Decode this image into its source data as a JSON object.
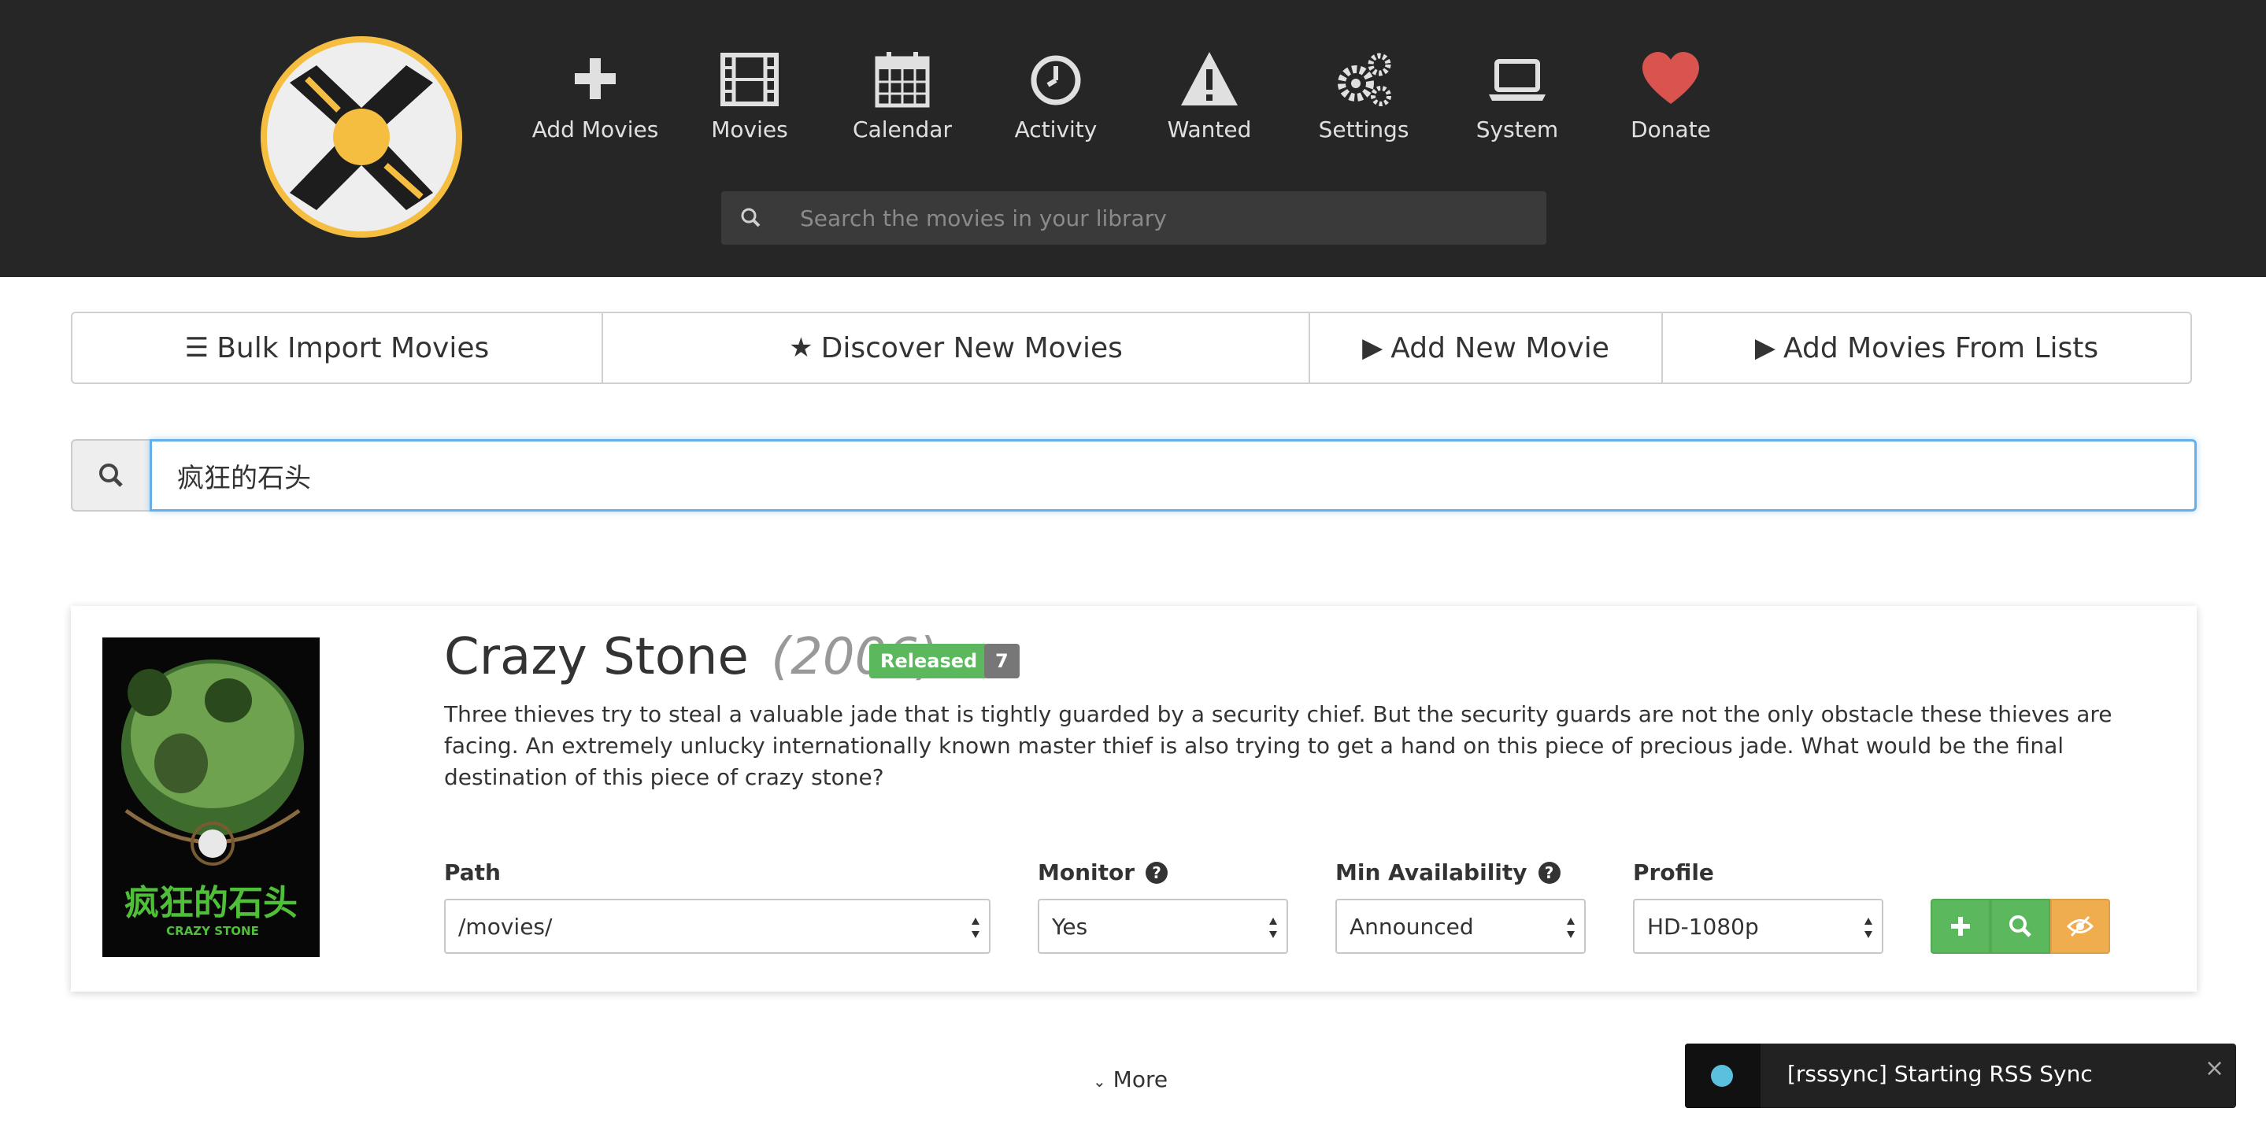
{
  "header": {
    "nav": [
      {
        "label": "Add Movies",
        "icon": "plus-icon"
      },
      {
        "label": "Movies",
        "icon": "film-icon"
      },
      {
        "label": "Calendar",
        "icon": "calendar-icon"
      },
      {
        "label": "Activity",
        "icon": "clock-icon"
      },
      {
        "label": "Wanted",
        "icon": "warning-icon"
      },
      {
        "label": "Settings",
        "icon": "gears-icon"
      },
      {
        "label": "System",
        "icon": "laptop-icon"
      },
      {
        "label": "Donate",
        "icon": "heart-icon"
      }
    ],
    "search_placeholder": "Search the movies in your library"
  },
  "actions": [
    {
      "label": "Bulk Import Movies",
      "icon": "list-icon"
    },
    {
      "label": "Discover New Movies",
      "icon": "star-icon"
    },
    {
      "label": "Add New Movie",
      "icon": "play-icon"
    },
    {
      "label": "Add Movies From Lists",
      "icon": "play-icon"
    }
  ],
  "search": {
    "value": "疯狂的石头"
  },
  "movie": {
    "title": "Crazy Stone",
    "year": "(2006)",
    "status": "Released",
    "rating": "7",
    "overview": "Three thieves try to steal a valuable jade that is tightly guarded by a security chief. But the security guards are not the only obstacle these thieves are facing. An extremely unlucky internationally known master thief is also trying to get a hand on this piece of precious jade. What would be the final destination of this piece of crazy stone?",
    "poster_text": "疯狂的石头",
    "poster_subtext": "CRAZY STONE",
    "fields": {
      "path_label": "Path",
      "path_value": "/movies/",
      "monitor_label": "Monitor",
      "monitor_value": "Yes",
      "min_availability_label": "Min Availability",
      "min_availability_value": "Announced",
      "profile_label": "Profile",
      "profile_value": "HD-1080p"
    }
  },
  "more_label": "More",
  "toast": {
    "text": "[rsssync] Starting RSS Sync",
    "close": "×"
  },
  "colors": {
    "header_bg": "#262626",
    "green": "#5cb85c",
    "orange": "#f0ad4e",
    "focus_blue": "#66afe9",
    "heart_red": "#d9534f",
    "logo_yellow": "#f5be41"
  }
}
